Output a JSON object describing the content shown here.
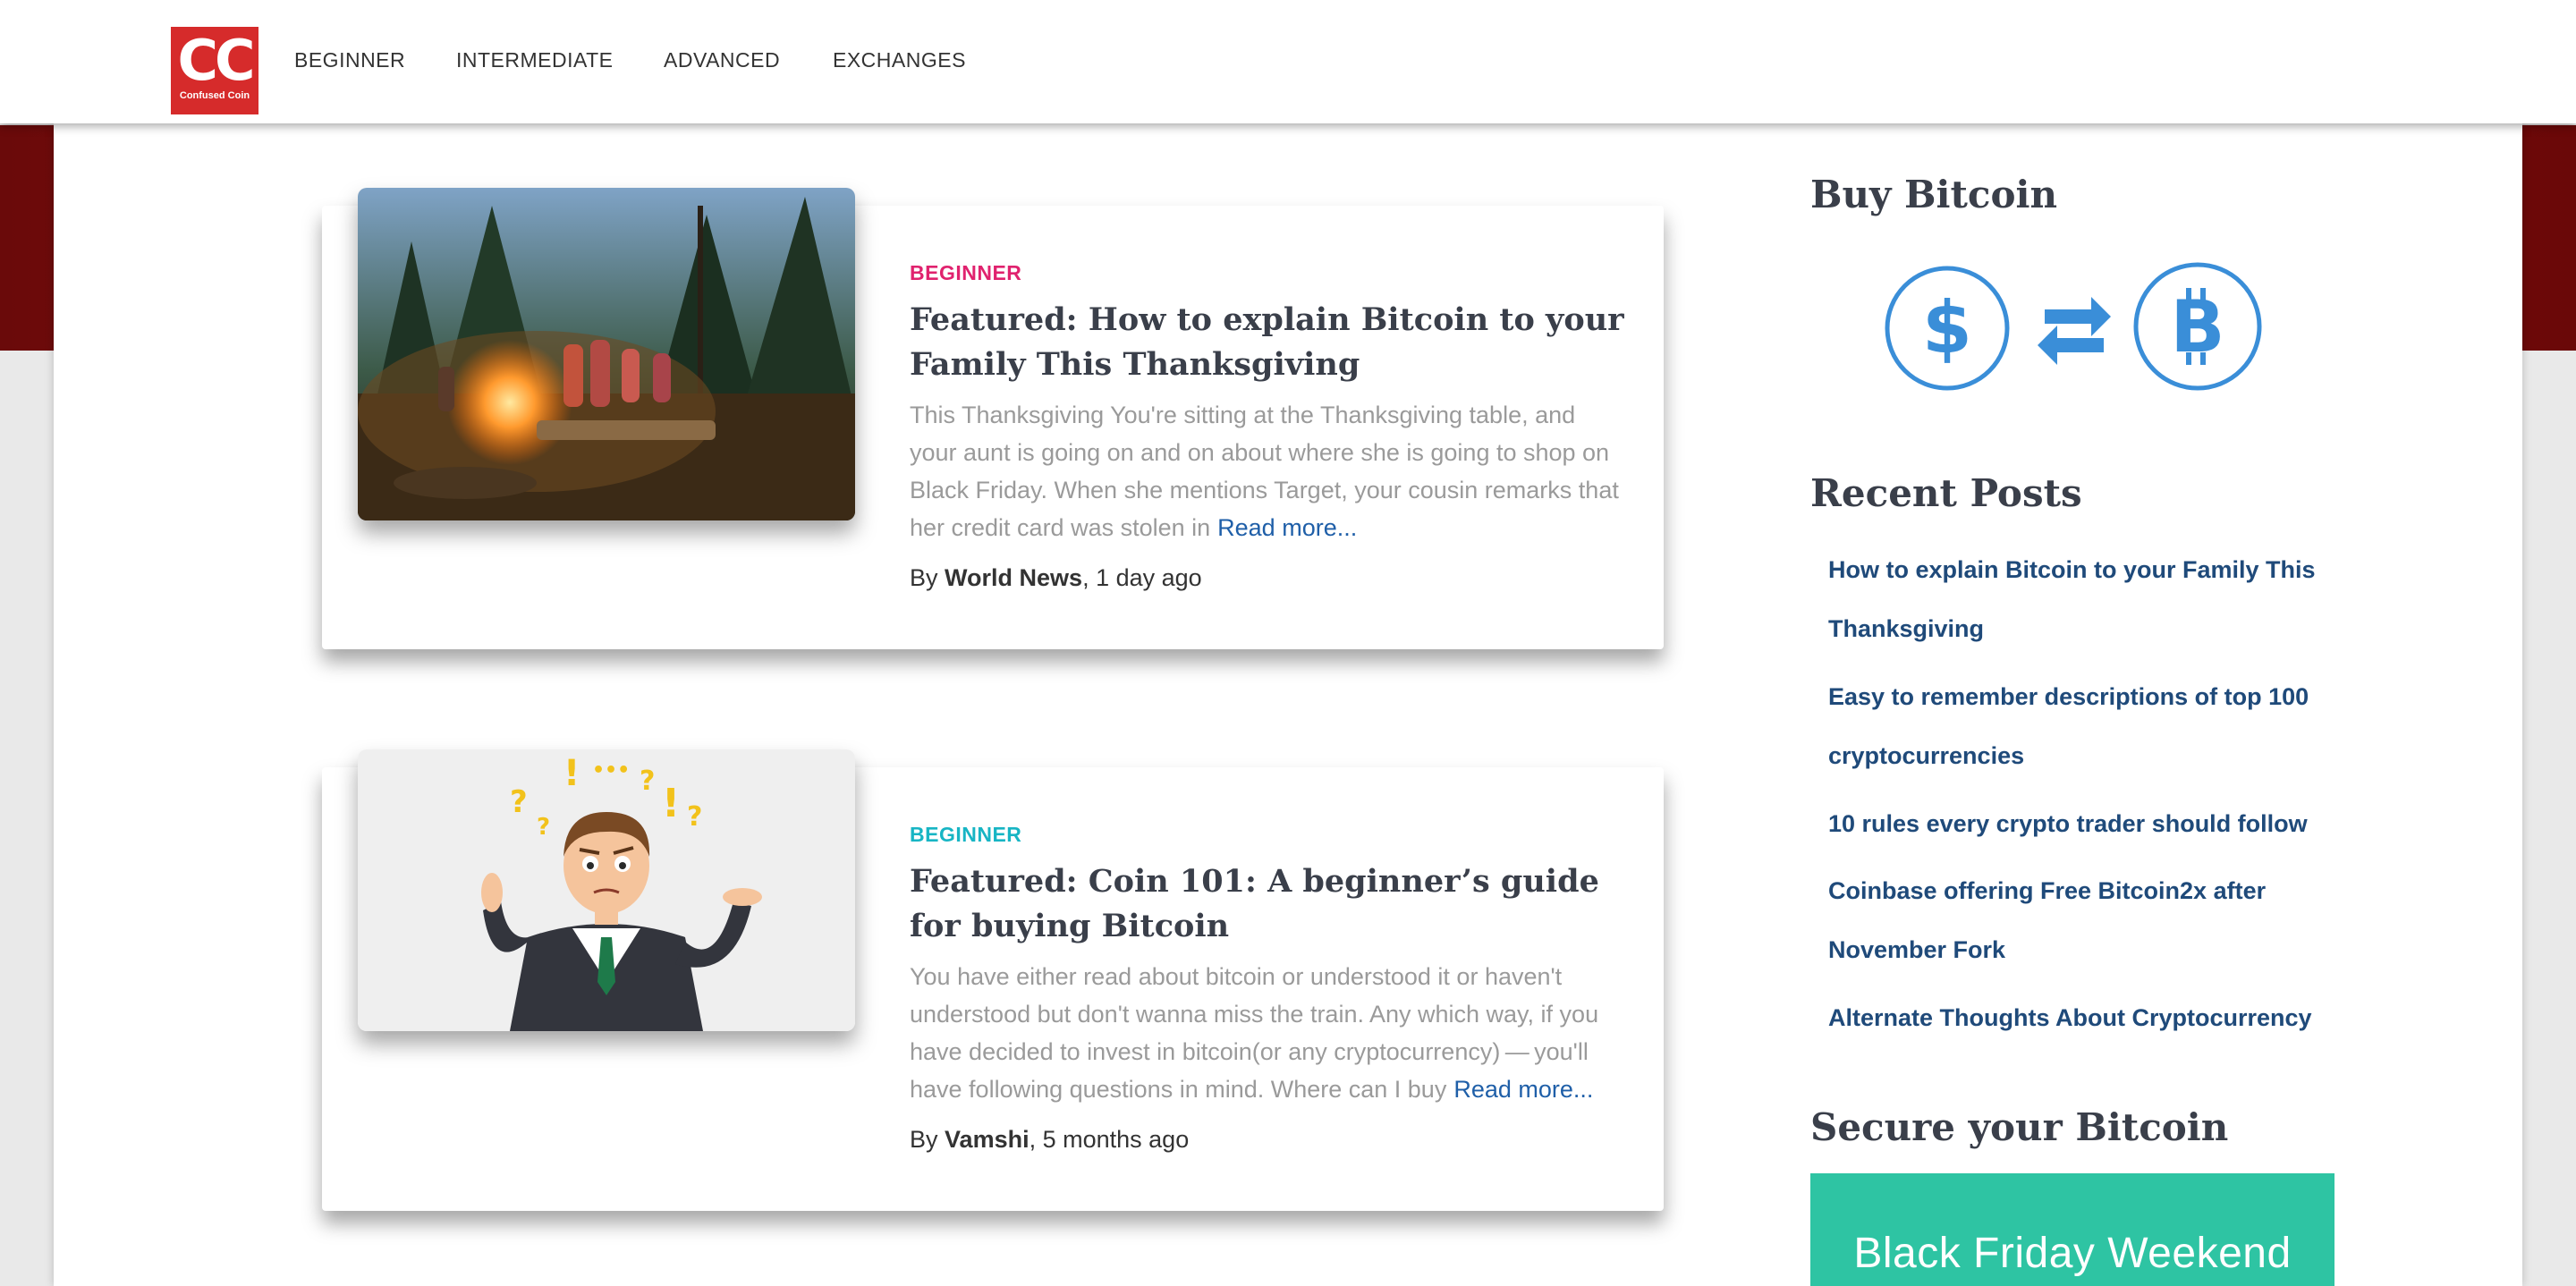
{
  "brand": {
    "logo_mark": "CC",
    "logo_sub": "Confused Coin"
  },
  "nav": [
    "BEGINNER",
    "INTERMEDIATE",
    "ADVANCED",
    "EXCHANGES"
  ],
  "posts": [
    {
      "category": "BEGINNER",
      "category_color": "#e0226e",
      "title": "Featured: How to explain Bitcoin to your Family This Thanksgiving",
      "excerpt": "This Thanksgiving  You're sitting at the Thanksgiving table, and your aunt is going on and on about where she is going to shop on Black Friday. When she mentions Target, your cousin remarks that her credit card was stolen in",
      "read_more": "Read more...",
      "by": "By",
      "author": "World News",
      "ago": ", 1 day ago"
    },
    {
      "category": "BEGINNER",
      "category_color": "#17b5c4",
      "title": "Featured: Coin 101: A beginner’s guide for buying Bitcoin",
      "excerpt": "You have either read about bitcoin or understood it or haven't understood but don't wanna miss the train. Any which way, if you have decided to invest in bitcoin(or any cryptocurrency) — you'll have following questions in mind. Where can I buy",
      "read_more": "Read more...",
      "by": "By",
      "author": "Vamshi",
      "ago": ", 5 months ago"
    }
  ],
  "sidebar": {
    "buy_title": "Buy Bitcoin",
    "buy_icons": [
      "dollar-icon",
      "exchange-arrows-icon",
      "bitcoin-icon"
    ],
    "recent_title": "Recent Posts",
    "recent_posts": [
      "How to explain Bitcoin to your Family This Thanksgiving",
      "Easy to remember descriptions of top 100 cryptocurrencies",
      "10 rules every crypto trader should follow",
      "Coinbase offering Free Bitcoin2x after November Fork",
      "Alternate Thoughts About Cryptocurrency"
    ],
    "secure_title": "Secure your Bitcoin",
    "promo_text": "Black Friday Weekend"
  },
  "colors": {
    "accent_blue": "#3a8ed8",
    "link": "#1f4a7a",
    "brand_red": "#d62b2b"
  }
}
